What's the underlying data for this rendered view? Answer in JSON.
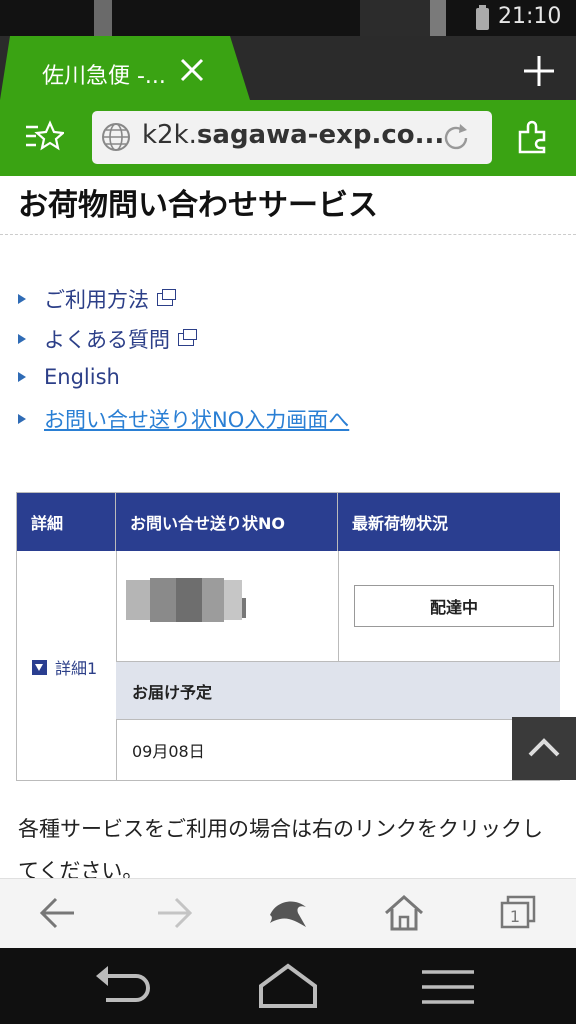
{
  "status_bar": {
    "time": "21:10"
  },
  "tab": {
    "title": "佐川急便 -..."
  },
  "address_bar": {
    "url_prefix": "k2k.",
    "url_domain": "sagawa-exp.co..."
  },
  "page": {
    "title": "お荷物問い合わせサービス",
    "nav_links": [
      {
        "label": "ご利用方法"
      },
      {
        "label": "よくある質問"
      },
      {
        "label": "English"
      },
      {
        "label": "お問い合せ送り状NO入力画面へ"
      }
    ],
    "table": {
      "headers": [
        "詳細",
        "お問い合せ送り状NO",
        "最新荷物状況"
      ],
      "detail_link": "詳細1",
      "status": "配達中",
      "eta_header": "お届け予定",
      "eta_date": "09月08日"
    },
    "info_text": "各種サービスをご利用の場合は右のリンクをクリックしてください。"
  },
  "colors": {
    "browser_green": "#3aa313",
    "table_header": "#2a3e90",
    "link": "#2a7fd4"
  }
}
